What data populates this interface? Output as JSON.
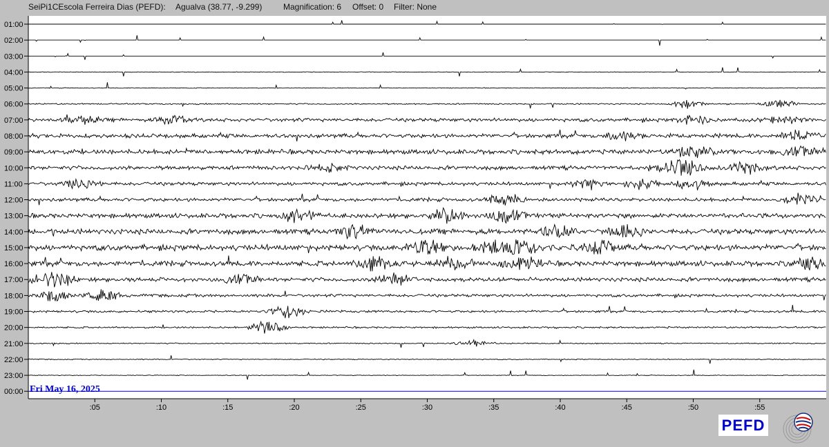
{
  "header": {
    "station": "SeiPi1CEscola Ferreira Dias (PEFD):",
    "location": "Agualva (38.77, -9.299)",
    "magnification": "Magnification: 6",
    "offset": "Offset: 0",
    "filter": "Filter: None"
  },
  "date_label": "Fri May 16, 2025",
  "logo": "PEFD",
  "colors": {
    "background": "#c0c0c0",
    "plot_bg": "#ffffff",
    "trace": "#000000",
    "current_line": "#0000cc"
  },
  "chart_data": {
    "type": "line",
    "title": "",
    "rows": [
      "01:00",
      "02:00",
      "03:00",
      "04:00",
      "05:00",
      "06:00",
      "07:00",
      "08:00",
      "09:00",
      "10:00",
      "11:00",
      "12:00",
      "13:00",
      "14:00",
      "15:00",
      "16:00",
      "17:00",
      "18:00",
      "19:00",
      "20:00",
      "21:00",
      "22:00",
      "23:00",
      "00:00"
    ],
    "x_ticks": [
      ":05",
      ":10",
      ":15",
      ":20",
      ":25",
      ":30",
      ":35",
      ":40",
      ":45",
      ":50",
      ":55"
    ],
    "x_tick_minutes": [
      5,
      10,
      15,
      20,
      25,
      30,
      35,
      40,
      45,
      50,
      55
    ],
    "xlim": [
      0,
      60
    ],
    "amplitude": [
      0,
      0,
      0,
      0.5,
      0.6,
      1.2,
      3,
      3.5,
      4,
      3.5,
      3,
      3,
      4,
      4.5,
      5,
      4.5,
      3.5,
      2.5,
      2,
      1.5,
      1,
      0.8,
      0.6,
      0
    ],
    "bursts": [
      {
        "row": "06:00",
        "minute": 49.5,
        "level": 5
      },
      {
        "row": "06:00",
        "minute": 56.5,
        "level": 5
      },
      {
        "row": "07:00",
        "minute": 4,
        "level": 5
      },
      {
        "row": "07:00",
        "minute": 11,
        "level": 5
      },
      {
        "row": "07:00",
        "minute": 50,
        "level": 6
      },
      {
        "row": "07:00",
        "minute": 57,
        "level": 5
      },
      {
        "row": "08:00",
        "minute": 45,
        "level": 6
      },
      {
        "row": "08:00",
        "minute": 58,
        "level": 6
      },
      {
        "row": "09:00",
        "minute": 50,
        "level": 7
      },
      {
        "row": "09:00",
        "minute": 58,
        "level": 6
      },
      {
        "row": "10:00",
        "minute": 22.5,
        "level": 5
      },
      {
        "row": "10:00",
        "minute": 48,
        "level": 6
      },
      {
        "row": "10:00",
        "minute": 49.5,
        "level": 8
      },
      {
        "row": "10:00",
        "minute": 54,
        "level": 7
      },
      {
        "row": "11:00",
        "minute": 4,
        "level": 6
      },
      {
        "row": "11:00",
        "minute": 42,
        "level": 6
      },
      {
        "row": "11:00",
        "minute": 46,
        "level": 6
      },
      {
        "row": "11:00",
        "minute": 50,
        "level": 7
      },
      {
        "row": "12:00",
        "minute": 36,
        "level": 8
      },
      {
        "row": "12:00",
        "minute": 58,
        "level": 6
      },
      {
        "row": "13:00",
        "minute": 20.5,
        "level": 8
      },
      {
        "row": "13:00",
        "minute": 31.5,
        "level": 9
      },
      {
        "row": "13:00",
        "minute": 36,
        "level": 9
      },
      {
        "row": "14:00",
        "minute": 24.5,
        "level": 9
      },
      {
        "row": "14:00",
        "minute": 40,
        "level": 10
      },
      {
        "row": "14:00",
        "minute": 45,
        "level": 9
      },
      {
        "row": "15:00",
        "minute": 30,
        "level": 9
      },
      {
        "row": "15:00",
        "minute": 35,
        "level": 10
      },
      {
        "row": "15:00",
        "minute": 37,
        "level": 10
      },
      {
        "row": "15:00",
        "minute": 43,
        "level": 9
      },
      {
        "row": "16:00",
        "minute": 26,
        "level": 9
      },
      {
        "row": "16:00",
        "minute": 32,
        "level": 9
      },
      {
        "row": "16:00",
        "minute": 37,
        "level": 9
      },
      {
        "row": "16:00",
        "minute": 59,
        "level": 8
      },
      {
        "row": "17:00",
        "minute": 1.2,
        "level": 7
      },
      {
        "row": "17:00",
        "minute": 2.4,
        "level": 8
      },
      {
        "row": "17:00",
        "minute": 16,
        "level": 6
      },
      {
        "row": "17:00",
        "minute": 27.5,
        "level": 7
      },
      {
        "row": "18:00",
        "minute": 2,
        "level": 8
      },
      {
        "row": "18:00",
        "minute": 5.5,
        "level": 7
      },
      {
        "row": "19:00",
        "minute": 19.5,
        "level": 8
      },
      {
        "row": "20:00",
        "minute": 18,
        "level": 8
      },
      {
        "row": "21:00",
        "minute": 33.5,
        "level": 5
      }
    ]
  }
}
